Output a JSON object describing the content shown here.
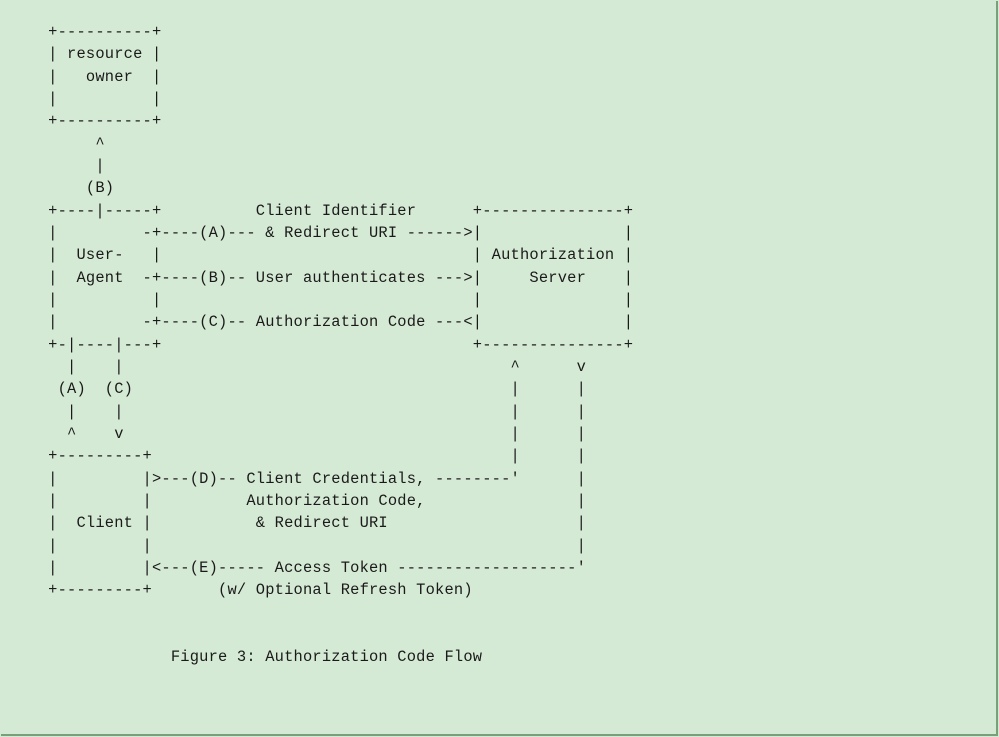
{
  "diagram": {
    "caption": "Figure 3: Authorization Code Flow",
    "actors": {
      "resource_owner": "resource\nowner",
      "user_agent": "User-\nAgent",
      "authorization_server": "Authorization\nServer",
      "client": "Client"
    },
    "flows": {
      "A": {
        "from": "Client",
        "via": "User-Agent",
        "to": "Authorization Server",
        "label": "Client Identifier & Redirect URI"
      },
      "B": {
        "from": "Authorization Server",
        "via": "User-Agent",
        "to": "resource owner",
        "label": "User authenticates"
      },
      "C": {
        "from": "Authorization Server",
        "via": "User-Agent",
        "to": "Client",
        "label": "Authorization Code"
      },
      "D": {
        "from": "Client",
        "to": "Authorization Server",
        "label": "Client Credentials, Authorization Code, & Redirect URI"
      },
      "E": {
        "from": "Authorization Server",
        "to": "Client",
        "label": "Access Token (w/ Optional Refresh Token)"
      }
    },
    "ascii_lines": [
      "     +----------+",
      "     | resource |",
      "     |   owner  |",
      "     |          |",
      "     +----------+",
      "          ^",
      "          |",
      "         (B)",
      "     +----|-----+          Client Identifier      +---------------+",
      "     |         -+----(A)--- & Redirect URI ------>|               |",
      "     |  User-   |                                 | Authorization |",
      "     |  Agent  -+----(B)-- User authenticates --->|     Server    |",
      "     |          |                                 |               |",
      "     |         -+----(C)-- Authorization Code ---<|               |",
      "     +-|----|---+                                 +---------------+",
      "       |    |                                         ^      v",
      "      (A)  (C)                                        |      |",
      "       |    |                                         |      |",
      "       ^    v                                         |      |",
      "     +---------+                                      |      |",
      "     |         |>---(D)-- Client Credentials, --------'      |",
      "     |         |          Authorization Code,                |",
      "     |  Client |           & Redirect URI                    |",
      "     |         |                                             |",
      "     |         |<---(E)----- Access Token -------------------'",
      "     +---------+       (w/ Optional Refresh Token)",
      "",
      "",
      "                  Figure 3: Authorization Code Flow"
    ]
  }
}
